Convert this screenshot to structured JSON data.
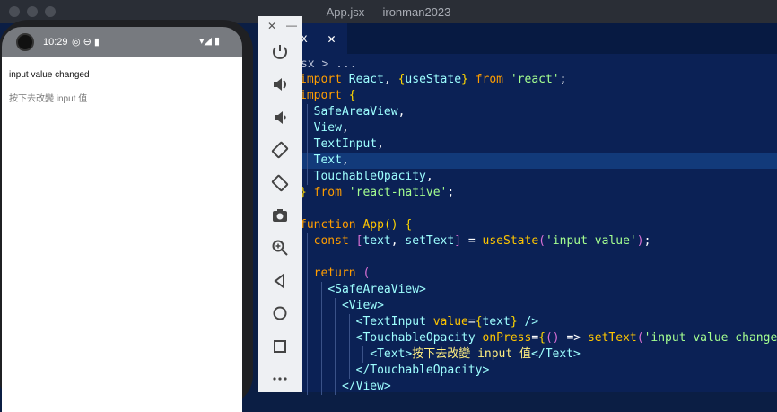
{
  "window": {
    "title": "App.jsx — ironman2023"
  },
  "editor": {
    "tab": {
      "name": "x",
      "close": "✕"
    },
    "breadcrumb": "sx > ...",
    "lines": [
      {
        "t": [
          [
            "kw",
            "import "
          ],
          [
            "id",
            "React"
          ],
          [
            "pn",
            ", "
          ],
          [
            "br",
            "{"
          ],
          [
            "id",
            "useState"
          ],
          [
            "br",
            "}"
          ],
          [
            "kw",
            " from "
          ],
          [
            "str",
            "'react'"
          ],
          [
            "pn",
            ";"
          ]
        ]
      },
      {
        "t": [
          [
            "kw",
            "import "
          ],
          [
            "br",
            "{"
          ]
        ]
      },
      {
        "g": [
          1
        ],
        "t": [
          [
            "pn",
            "  "
          ],
          [
            "id",
            "SafeAreaView"
          ],
          [
            "pn",
            ","
          ]
        ]
      },
      {
        "g": [
          1
        ],
        "t": [
          [
            "pn",
            "  "
          ],
          [
            "id",
            "View"
          ],
          [
            "pn",
            ","
          ]
        ]
      },
      {
        "g": [
          1
        ],
        "t": [
          [
            "pn",
            "  "
          ],
          [
            "id",
            "TextInput"
          ],
          [
            "pn",
            ","
          ]
        ]
      },
      {
        "g": [
          1
        ],
        "hl": true,
        "t": [
          [
            "pn",
            "  "
          ],
          [
            "id",
            "Text"
          ],
          [
            "pn",
            ","
          ]
        ]
      },
      {
        "g": [
          1
        ],
        "t": [
          [
            "pn",
            "  "
          ],
          [
            "id",
            "TouchableOpacity"
          ],
          [
            "pn",
            ","
          ]
        ]
      },
      {
        "t": [
          [
            "br",
            "}"
          ],
          [
            "kw",
            " from "
          ],
          [
            "str",
            "'react-native'"
          ],
          [
            "pn",
            ";"
          ]
        ]
      },
      {
        "t": []
      },
      {
        "t": [
          [
            "kw",
            "function "
          ],
          [
            "fn",
            "App"
          ],
          [
            "br",
            "()"
          ],
          [
            "pn",
            " "
          ],
          [
            "br",
            "{"
          ]
        ]
      },
      {
        "g": [
          1
        ],
        "t": [
          [
            "pn",
            "  "
          ],
          [
            "kw",
            "const "
          ],
          [
            "br2",
            "["
          ],
          [
            "id",
            "text"
          ],
          [
            "pn",
            ", "
          ],
          [
            "id",
            "setText"
          ],
          [
            "br2",
            "]"
          ],
          [
            "pn",
            " = "
          ],
          [
            "fn",
            "useState"
          ],
          [
            "br2",
            "("
          ],
          [
            "str",
            "'input value'"
          ],
          [
            "br2",
            ")"
          ],
          [
            "pn",
            ";"
          ]
        ]
      },
      {
        "g": [
          1
        ],
        "t": []
      },
      {
        "g": [
          1
        ],
        "t": [
          [
            "pn",
            "  "
          ],
          [
            "kw",
            "return "
          ],
          [
            "br2",
            "("
          ]
        ]
      },
      {
        "g": [
          1,
          2
        ],
        "t": [
          [
            "pn",
            "    "
          ],
          [
            "tag",
            "<SafeAreaView>"
          ]
        ]
      },
      {
        "g": [
          1,
          2,
          3
        ],
        "t": [
          [
            "pn",
            "      "
          ],
          [
            "tag",
            "<View>"
          ]
        ]
      },
      {
        "g": [
          1,
          2,
          3,
          4
        ],
        "t": [
          [
            "pn",
            "        "
          ],
          [
            "tag",
            "<TextInput "
          ],
          [
            "attr",
            "value"
          ],
          [
            "pn",
            "="
          ],
          [
            "br",
            "{"
          ],
          [
            "id",
            "text"
          ],
          [
            "br",
            "}"
          ],
          [
            "tag",
            " />"
          ]
        ]
      },
      {
        "g": [
          1,
          2,
          3,
          4
        ],
        "t": [
          [
            "pn",
            "        "
          ],
          [
            "tag",
            "<TouchableOpacity "
          ],
          [
            "attr",
            "onPress"
          ],
          [
            "pn",
            "="
          ],
          [
            "br",
            "{"
          ],
          [
            "br2",
            "()"
          ],
          [
            "pn",
            " => "
          ],
          [
            "fn",
            "setText"
          ],
          [
            "br2",
            "("
          ],
          [
            "str",
            "'input value changed'"
          ],
          [
            "br2",
            ")"
          ],
          [
            "br",
            "}"
          ],
          [
            "tag",
            ">"
          ]
        ]
      },
      {
        "g": [
          1,
          2,
          3,
          4,
          5
        ],
        "t": [
          [
            "pn",
            "          "
          ],
          [
            "tag",
            "<Text>"
          ],
          [
            "cn",
            "按下去改變 input 值"
          ],
          [
            "tag",
            "</Text>"
          ]
        ]
      },
      {
        "g": [
          1,
          2,
          3,
          4
        ],
        "t": [
          [
            "pn",
            "        "
          ],
          [
            "tag",
            "</TouchableOpacity>"
          ]
        ]
      },
      {
        "g": [
          1,
          2,
          3
        ],
        "t": [
          [
            "pn",
            "      "
          ],
          [
            "tag",
            "</View>"
          ]
        ]
      }
    ]
  },
  "emulator_toolbar": {
    "close": "✕",
    "minimize": "—",
    "buttons": [
      "power-icon",
      "volume-up-icon",
      "volume-down-icon",
      "rotate-left-icon",
      "rotate-right-icon",
      "camera-icon",
      "zoom-icon",
      "back-icon",
      "home-icon",
      "overview-icon",
      "more-icon"
    ]
  },
  "phone": {
    "status_time": "10:29",
    "status_icons": "◎ ⊖ ▮",
    "status_right": "▾◢ ▮",
    "text_value": "input value changed",
    "button_text": "按下去改變 input 值"
  }
}
